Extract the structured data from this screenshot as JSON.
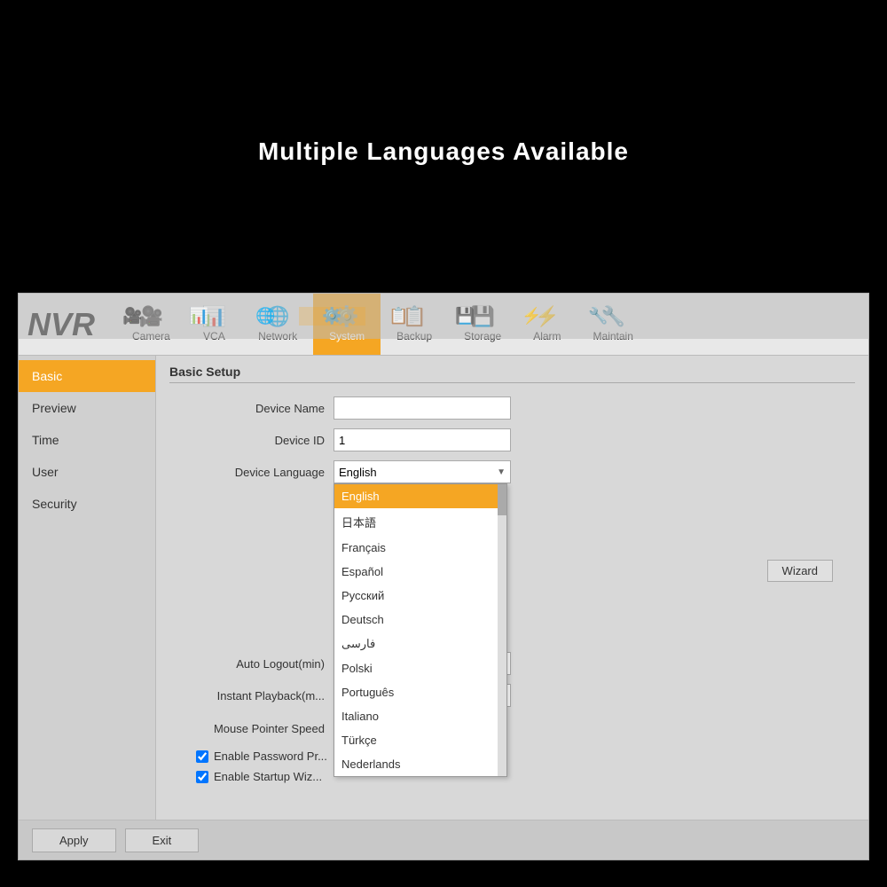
{
  "hero": {
    "title": "Multiple Languages Available"
  },
  "logo": "NVR",
  "nav": {
    "items": [
      {
        "id": "camera",
        "label": "Camera",
        "icon": "🎥"
      },
      {
        "id": "vca",
        "label": "VCA",
        "icon": "📊"
      },
      {
        "id": "network",
        "label": "Network",
        "icon": "🌐"
      },
      {
        "id": "system",
        "label": "System",
        "icon": "⚙️",
        "active": true
      },
      {
        "id": "backup",
        "label": "Backup",
        "icon": "📋"
      },
      {
        "id": "storage",
        "label": "Storage",
        "icon": "💾"
      },
      {
        "id": "alarm",
        "label": "Alarm",
        "icon": "⚡"
      },
      {
        "id": "maintain",
        "label": "Maintain",
        "icon": "🔧"
      }
    ]
  },
  "sidebar": {
    "items": [
      {
        "id": "basic",
        "label": "Basic",
        "active": true
      },
      {
        "id": "preview",
        "label": "Preview"
      },
      {
        "id": "time",
        "label": "Time"
      },
      {
        "id": "user",
        "label": "User"
      },
      {
        "id": "security",
        "label": "Security"
      }
    ]
  },
  "section_title": "Basic Setup",
  "form": {
    "device_name_label": "Device Name",
    "device_name_value": "",
    "device_id_label": "Device ID",
    "device_id_value": "1",
    "device_language_label": "Device Language",
    "device_language_value": "English",
    "auto_logout_label": "Auto Logout(min)",
    "auto_logout_value": "",
    "instant_playback_label": "Instant Playback(m...",
    "instant_playback_value": "",
    "mouse_speed_label": "Mouse Pointer Speed",
    "checkbox1": "Enable Password Pr...",
    "checkbox2": "Enable Startup Wiz..."
  },
  "dropdown": {
    "options": [
      {
        "label": "English",
        "selected": true
      },
      {
        "label": "日本語",
        "selected": false
      },
      {
        "label": "Français",
        "selected": false
      },
      {
        "label": "Español",
        "selected": false
      },
      {
        "label": "Русский",
        "selected": false
      },
      {
        "label": "Deutsch",
        "selected": false
      },
      {
        "label": "فارسی",
        "selected": false
      },
      {
        "label": "Polski",
        "selected": false
      },
      {
        "label": "Português",
        "selected": false
      },
      {
        "label": "Italiano",
        "selected": false
      },
      {
        "label": "Türkçe",
        "selected": false
      },
      {
        "label": "Nederlands",
        "selected": false
      }
    ]
  },
  "buttons": {
    "wizard": "Wizard",
    "apply": "Apply",
    "exit": "Exit"
  }
}
